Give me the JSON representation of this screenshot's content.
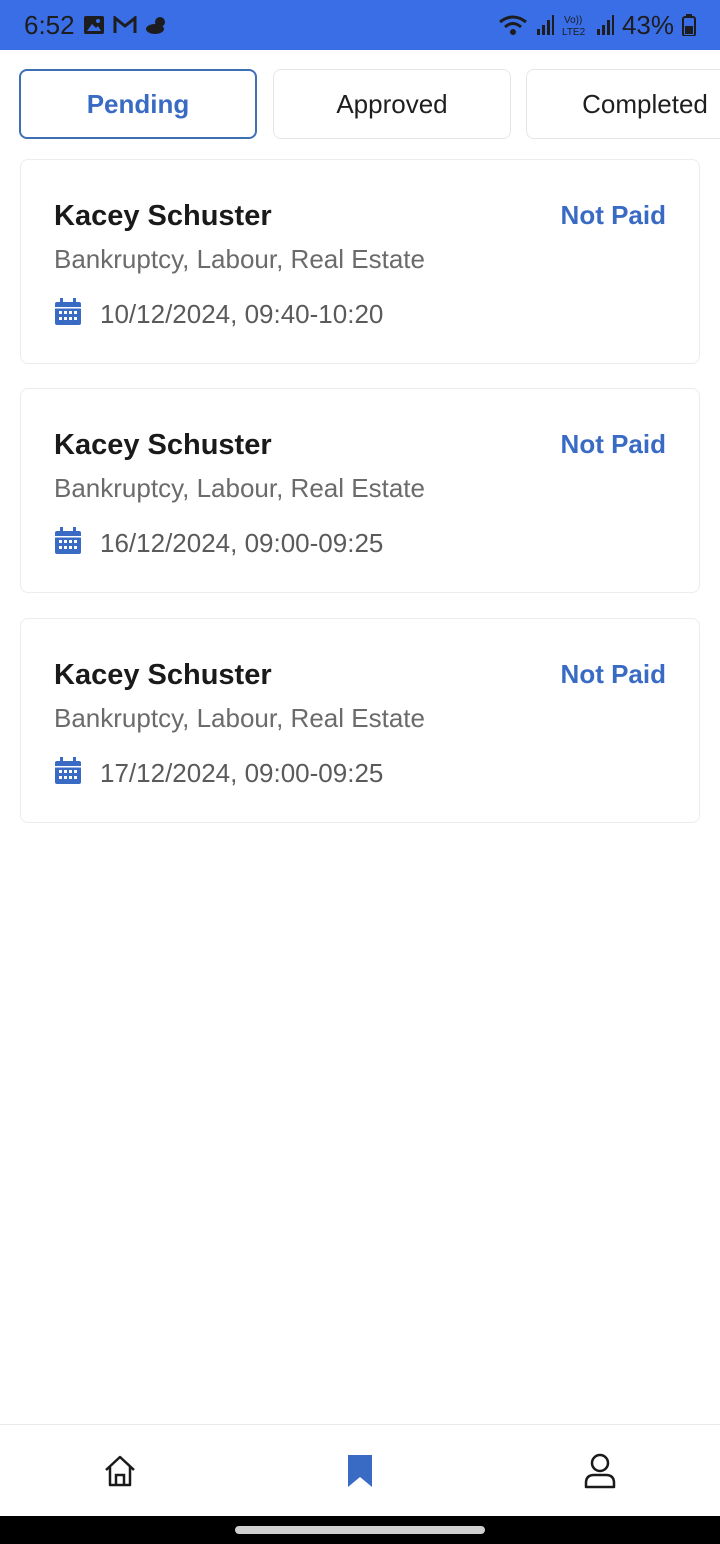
{
  "status_bar": {
    "time": "6:52",
    "battery": "43%",
    "icons": [
      "image-icon",
      "gmail-icon",
      "weather-icon",
      "wifi-icon",
      "signal-icon",
      "volte-icon",
      "battery-icon"
    ]
  },
  "tabs": [
    {
      "label": "Pending",
      "active": true
    },
    {
      "label": "Approved",
      "active": false
    },
    {
      "label": "Completed",
      "active": false
    }
  ],
  "appointments": [
    {
      "name": "Kacey Schuster",
      "payment_status": "Not Paid",
      "practice_areas": "Bankruptcy, Labour, Real Estate",
      "datetime": "10/12/2024, 09:40-10:20"
    },
    {
      "name": "Kacey Schuster",
      "payment_status": "Not Paid",
      "practice_areas": "Bankruptcy, Labour, Real Estate",
      "datetime": "16/12/2024, 09:00-09:25"
    },
    {
      "name": "Kacey Schuster",
      "payment_status": "Not Paid",
      "practice_areas": "Bankruptcy, Labour, Real Estate",
      "datetime": "17/12/2024, 09:00-09:25"
    }
  ],
  "bottom_nav": [
    {
      "icon": "home-icon",
      "active": false
    },
    {
      "icon": "bookmark-icon",
      "active": true
    },
    {
      "icon": "profile-icon",
      "active": false
    }
  ],
  "colors": {
    "accent": "#3a6bc4",
    "status_bar": "#3a6ee6",
    "active_tab_border": "#3f6fb5"
  }
}
